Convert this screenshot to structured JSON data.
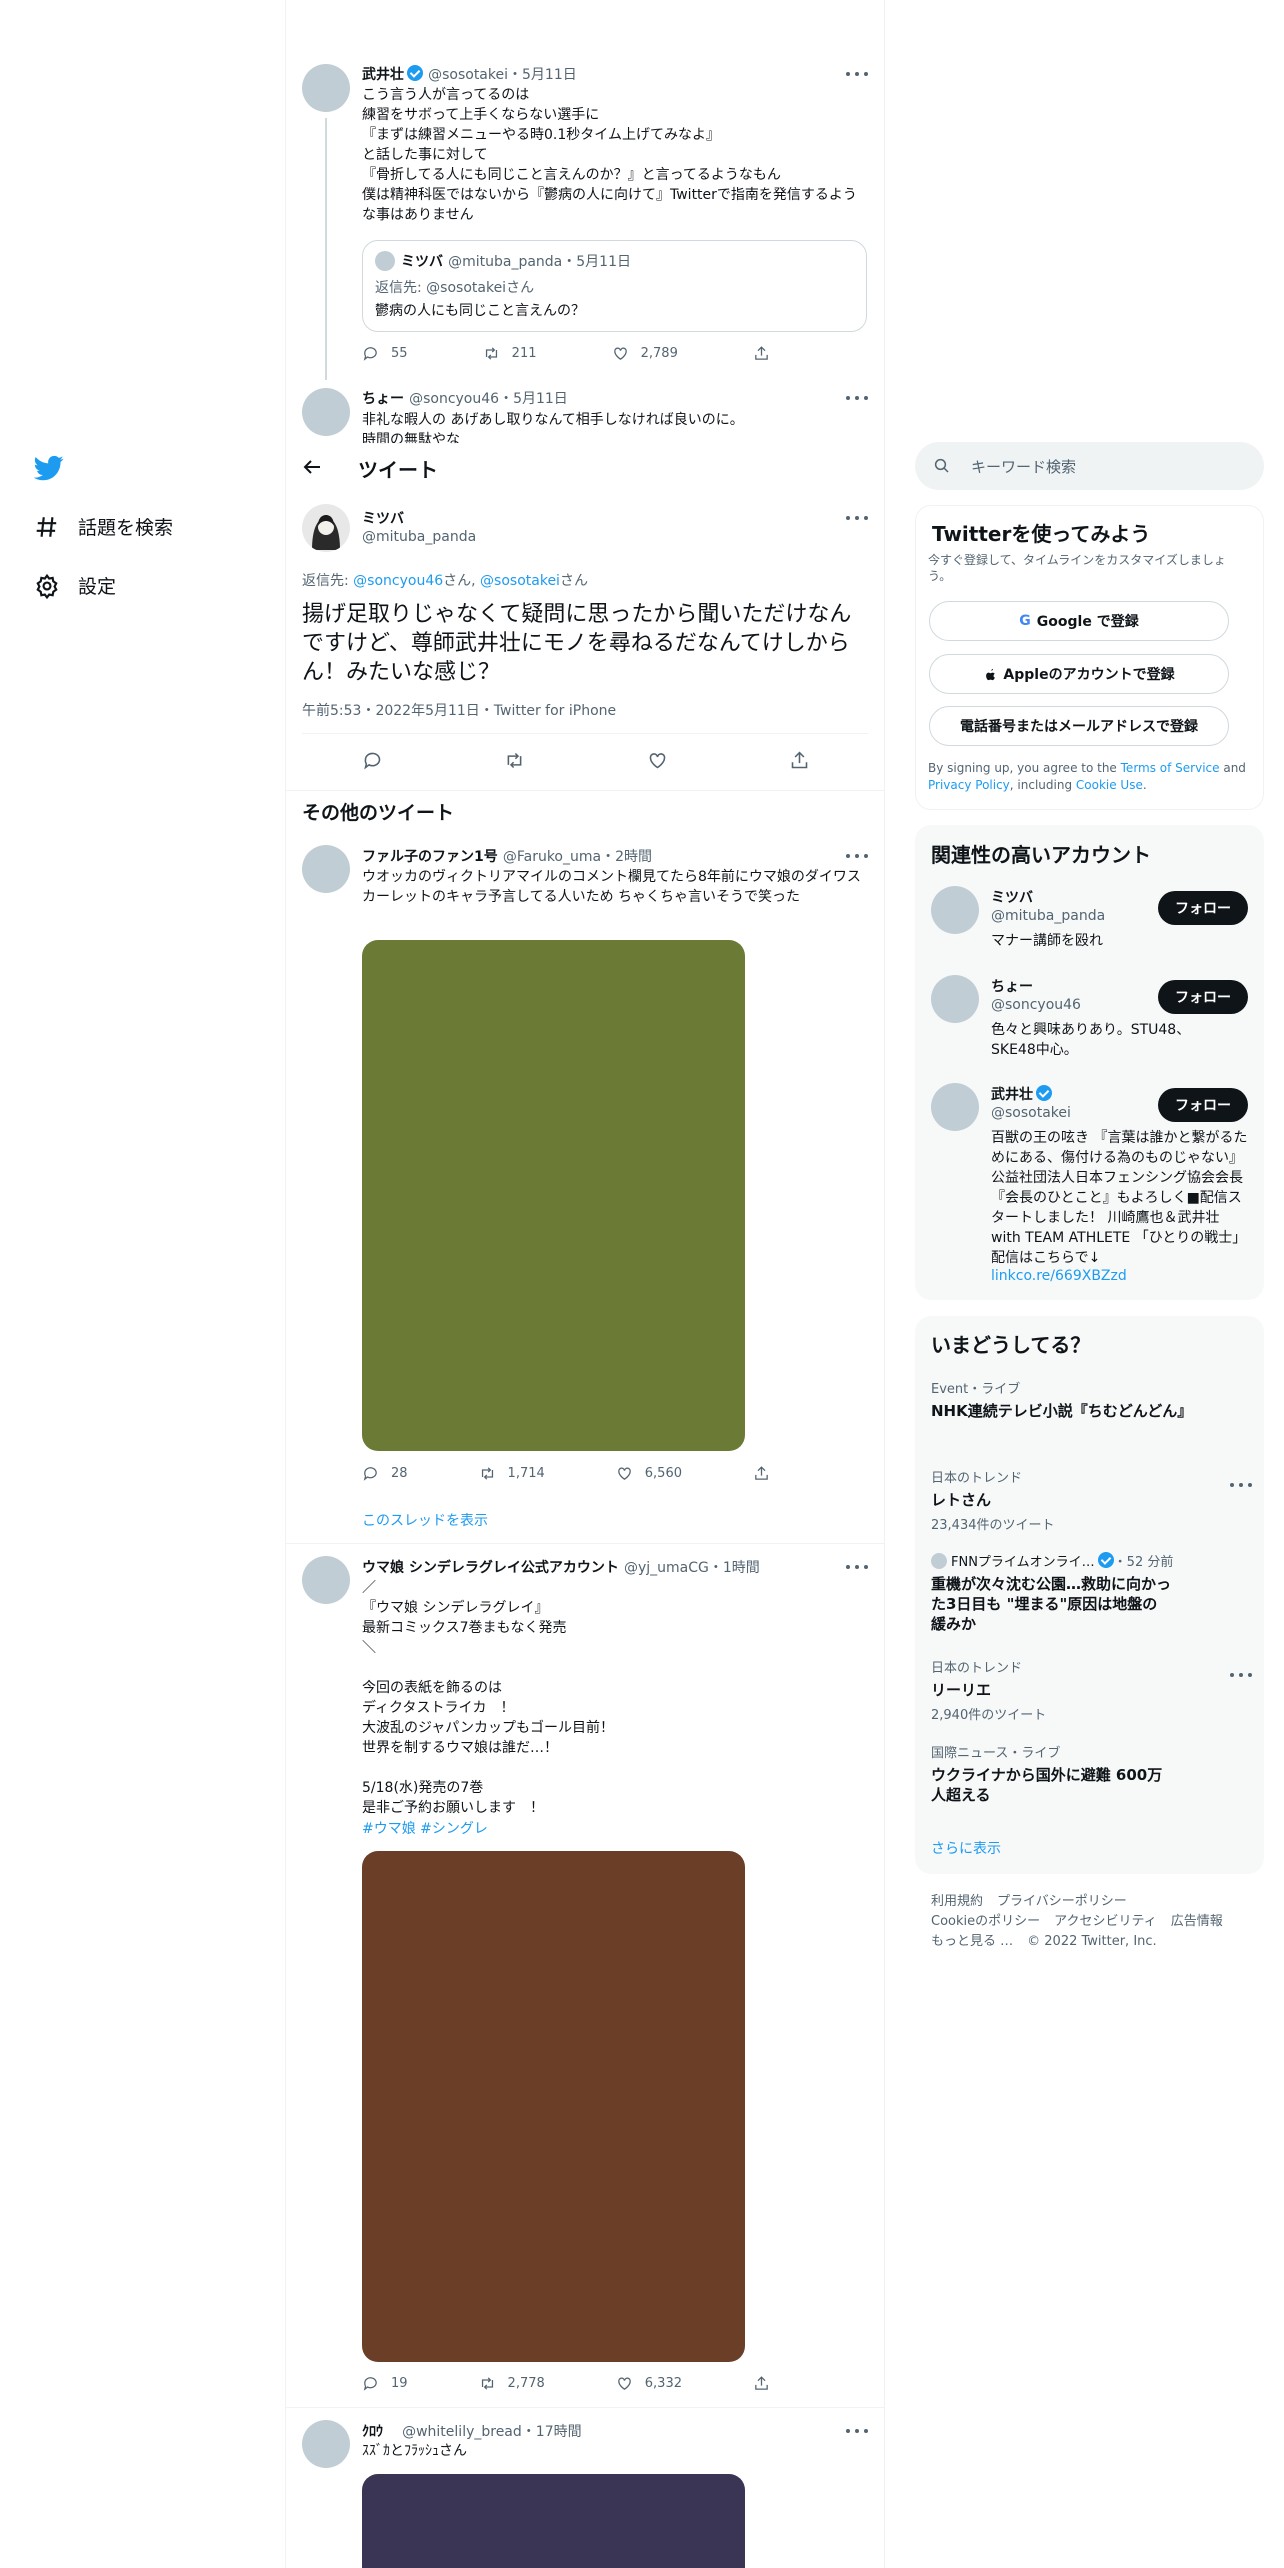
{
  "nav": {
    "explore_label": "話題を検索",
    "settings_label": "設定"
  },
  "colors": {
    "accent": "#1d9bf0",
    "media1": "#6b7b36",
    "media2": "#6b3f27",
    "media3": "#3a3555"
  },
  "thread": [
    {
      "name": "武井壮",
      "handle": "@sosotakei",
      "time": "5月11日",
      "text": "こう言う人が言ってるのは\n練習をサボって上手くならない選手に\n『まずは練習メニューやる時0.1秒タイム上げてみなよ』\nと話した事に対して\n『骨折してる人にも同じこと言えんのか？』と言ってるようなもん\n僕は精神科医ではないから『鬱病の人に向けて』Twitterで指南を発信するような事はありません",
      "quote": {
        "name": "ミツバ",
        "handle": "@mituba_panda",
        "time": "5月11日",
        "reply_prefix": "返信先: ",
        "reply_handle": "@sosotakei",
        "reply_suffix": "さん",
        "text": "鬱病の人にも同じこと言えんの？"
      },
      "replies": "55",
      "retweets": "211",
      "likes": "2,789"
    },
    {
      "name": "ちょー",
      "handle": "@soncyou46",
      "time": "5月11日",
      "text": "非礼な暇人の あげあし取りなんて相手しなければ良いのに。\n時間の無駄やな"
    }
  ],
  "header": {
    "title": "ツイート"
  },
  "main_tweet": {
    "name": "ミツバ",
    "handle": "@mituba_panda",
    "reply_prefix": "返信先: ",
    "reply_handle1": "@soncyou46",
    "reply_mid": "さん, ",
    "reply_handle2": "@sosotakei",
    "reply_suffix": "さん",
    "text": "揚げ足取りじゃなくて疑問に思ったから聞いただけなんですけど、尊師武井壮にモノを尋ねるだなんてけしからん！みたいな感じ？",
    "meta": "午前5:53・2022年5月11日・Twitter for iPhone"
  },
  "more_tweets": {
    "heading": "その他のツイート",
    "items": [
      {
        "name": "ファル子のファン1号",
        "handle": "@Faruko_uma",
        "time": "2時間",
        "text": "ウオッカのヴィクトリアマイルのコメント欄見てたら8年前にウマ娘のダイワスカーレットのキャラ予言してる人いため ちゃくちゃ言いそうで笑った",
        "replies": "28",
        "retweets": "1,714",
        "likes": "6,560",
        "show_thread": "このスレッドを表示"
      },
      {
        "name": "ウマ娘 シンデレラグレイ公式アカウント",
        "handle": "@yj_umaCG",
        "time": "1時間",
        "text": "／\n『ウマ娘 シンデレラグレイ』\n最新コミックス7巻まもなく発売\n＼\n\n今回の表紙を飾るのは\nディクタストライカ　！\n大波乱のジャパンカップもゴール目前！\n世界を制するウマ娘は誰だ…！\n\n5/18(水)発売の7巻\n是非ご予約お願いします　！",
        "hashtags": "#ウマ娘 #シングレ",
        "replies": "19",
        "retweets": "2,778",
        "likes": "6,332"
      },
      {
        "name": "ｸﾛｳ",
        "handle": "@whitelily_bread",
        "time": "17時間",
        "text": "ｽｽﾞｶとﾌﾗｯｼｭさん"
      }
    ]
  },
  "search": {
    "placeholder": "キーワード検索"
  },
  "signup": {
    "title": "Twitterを使ってみよう",
    "subtitle": "今すぐ登録して、タイムラインをカスタマイズしましょう。",
    "google_label": "Google で登録",
    "apple_label": "Appleのアカウントで登録",
    "phone_label": "電話番号またはメールアドレスで登録",
    "legal_prefix": "By signing up, you agree to the ",
    "terms": "Terms of Service",
    "legal_and": " and ",
    "privacy": "Privacy Policy",
    "legal_including": ", including ",
    "cookie": "Cookie Use",
    "legal_end": "."
  },
  "related": {
    "title": "関連性の高いアカウント",
    "follow_label": "フォロー",
    "accounts": [
      {
        "name": "ミツバ",
        "handle": "@mituba_panda",
        "bio": "マナー講師を殴れ"
      },
      {
        "name": "ちょー",
        "handle": "@soncyou46",
        "bio": "色々と興味ありあり。STU48、SKE48中心。"
      },
      {
        "name": "武井壮",
        "handle": "@sosotakei",
        "bio": "百獣の王の呟き 『言葉は誰かと繋がるためにある、傷付ける為のものじゃない』 公益社団法人日本フェンシング協会会長 『会長のひとこと』もよろしく■配信スタートしました！ 川崎鷹也＆武井壮 with TEAM ATHLETE 「ひとりの戦士」 配信はこちらで↓",
        "link": "linkco.re/669XBZzd"
      }
    ]
  },
  "trends": {
    "title": "いまどうしてる？",
    "items": [
      {
        "context": "Event・ライブ",
        "title": "NHK連続テレビ小説『ちむどんどん』"
      },
      {
        "context": "日本のトレンド",
        "title": "レトさん",
        "count": "23,434件のツイート"
      },
      {
        "context": "FNNプライムオンライ…",
        "context_time": "・52 分前",
        "title": "重機が次々沈む公園…救助に向かった3日目も \"埋まる\"原因は地盤の緩みか"
      },
      {
        "context": "日本のトレンド",
        "title": "リーリエ",
        "count": "2,940件のツイート"
      },
      {
        "context": "国際ニュース・ライブ",
        "title": "ウクライナから国外に避難 600万人超える"
      }
    ],
    "show_more": "さらに表示"
  },
  "footer": {
    "terms": "利用規約",
    "privacy": "プライバシーポリシー",
    "cookie": "Cookieのポリシー",
    "accessibility": "アクセシビリティ",
    "ads": "広告情報",
    "more": "もっと見る …",
    "copyright": "© 2022 Twitter, Inc."
  }
}
